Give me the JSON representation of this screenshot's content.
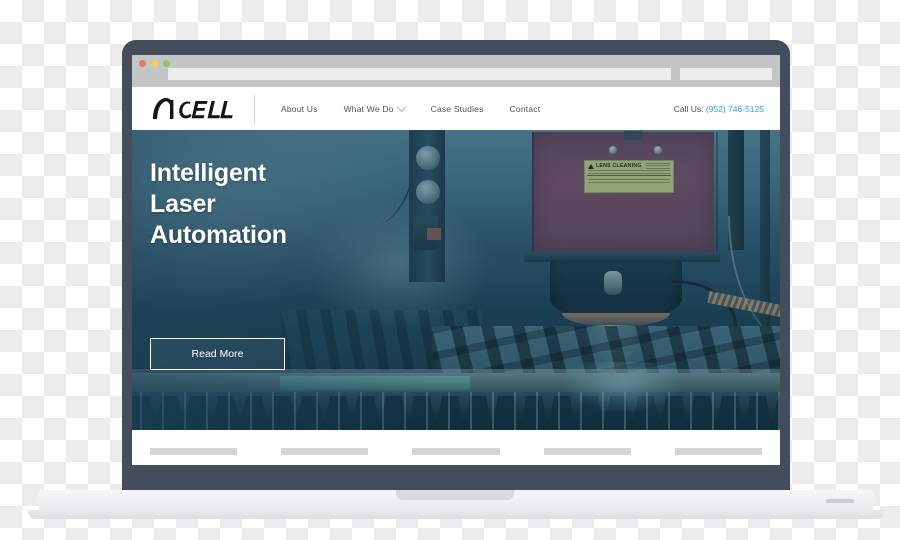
{
  "window": {
    "traffic_lights": [
      "close-red",
      "minimize-yellow",
      "maximize-green"
    ],
    "address_bar_value": "",
    "address_bar_placeholder": "",
    "search_bar_value": "",
    "search_bar_placeholder": ""
  },
  "site": {
    "brand": {
      "logo_text": "NCELL",
      "logo_icon": "ncell-wordmark-logo"
    },
    "nav": {
      "items": [
        {
          "label": "About Us",
          "has_dropdown": false
        },
        {
          "label": "What We Do",
          "has_dropdown": true,
          "icon": "chevron-down-icon"
        },
        {
          "label": "Case Studies",
          "has_dropdown": false
        },
        {
          "label": "Contact",
          "has_dropdown": false
        }
      ],
      "phone": {
        "prefix": "Call Us:",
        "number": "(952) 746-5125",
        "link_color": "#3d9be9"
      }
    },
    "hero": {
      "headline": "Intelligent\nLaser\nAutomation",
      "cta_label": "Read More",
      "background_image": "laser-cutting-machine-photo",
      "image_caption_label": "LENS CLEANING",
      "overlay_color": "#1e465c"
    },
    "footer_placeholders": [
      {
        "name": "placeholder-bar-1"
      },
      {
        "name": "placeholder-bar-2"
      },
      {
        "name": "placeholder-bar-3"
      },
      {
        "name": "placeholder-bar-4"
      },
      {
        "name": "placeholder-bar-5"
      }
    ]
  },
  "device": {
    "type": "laptop-mockup",
    "bezel_color": "#454d5d",
    "base_color": "#eceef0"
  }
}
